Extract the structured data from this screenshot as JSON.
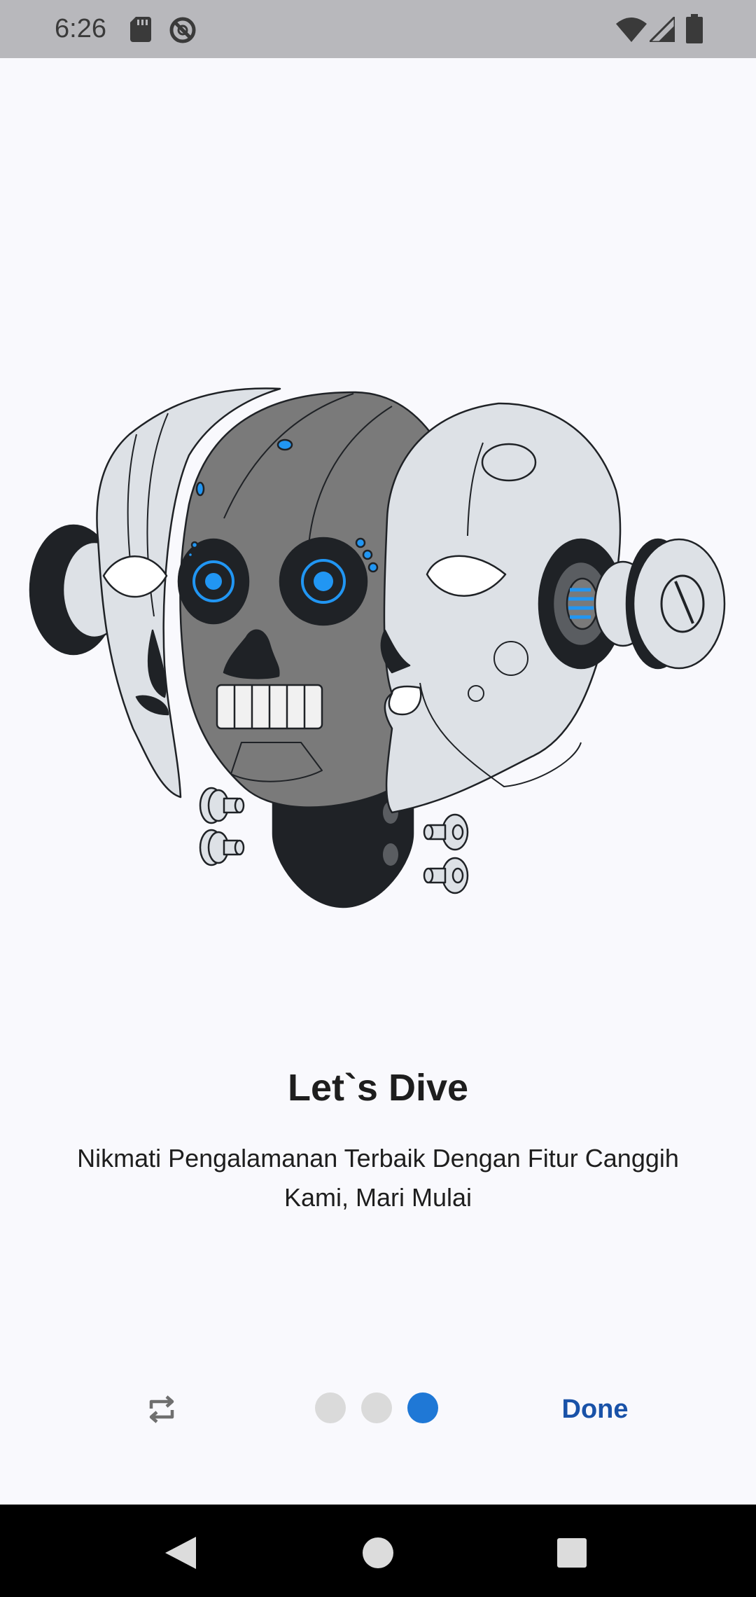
{
  "status_bar": {
    "time": "6:26",
    "left_icons": [
      "sd-card-icon",
      "no-sync-icon"
    ],
    "right_icons": [
      "wifi-icon",
      "signal-icon",
      "battery-icon"
    ]
  },
  "illustration": {
    "icon": "robot-head-illustration",
    "accent_color": "#2196f3"
  },
  "content": {
    "title": "Let`s Dive",
    "subtitle": "Nikmati Pengalamanan Terbaik Dengan Fitur Canggih Kami, Mari Mulai"
  },
  "pager": {
    "page_count": 3,
    "active_index": 2,
    "active_color": "#1f78d6",
    "inactive_color": "#dadada"
  },
  "actions": {
    "skip_icon": "repeat-icon",
    "done_label": "Done",
    "done_color": "#1952a8"
  },
  "navigation_bar": {
    "buttons": [
      "back-icon",
      "home-icon",
      "recents-icon"
    ]
  }
}
